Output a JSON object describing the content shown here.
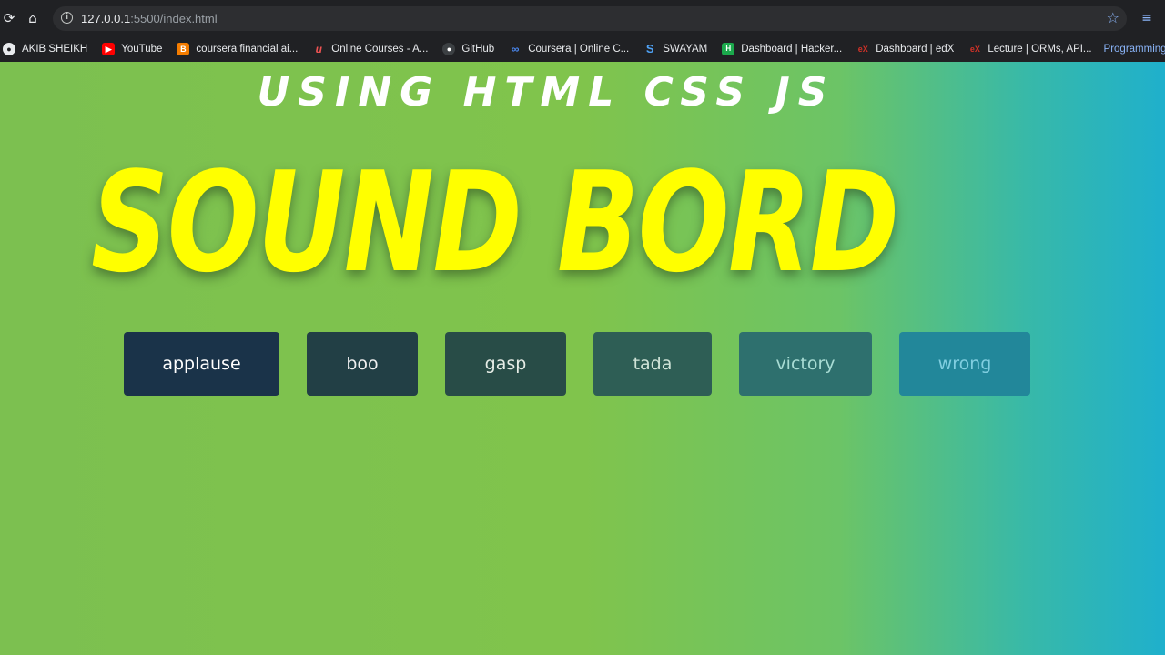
{
  "browser": {
    "url_host": "127.0.0.1",
    "url_path": ":5500/index.html",
    "bookmarks": [
      {
        "label": "AKIB SHEIKH",
        "icon": "globe-icon",
        "color": "#5f6368"
      },
      {
        "label": "YouTube",
        "icon": "youtube-icon",
        "color": "#ff0000"
      },
      {
        "label": "coursera financial ai...",
        "icon": "blogger-icon",
        "color": "#f57d00"
      },
      {
        "label": "Online Courses - A...",
        "icon": "udemy-icon",
        "color": "#ec5252"
      },
      {
        "label": "GitHub",
        "icon": "github-icon",
        "color": "#24292e"
      },
      {
        "label": "Coursera | Online C...",
        "icon": "coursera-icon",
        "color": "#0056d2"
      },
      {
        "label": "SWAYAM",
        "icon": "swayam-icon",
        "color": "#1a73e8"
      },
      {
        "label": "Dashboard | Hacker...",
        "icon": "hackerrank-icon",
        "color": "#2ec866"
      },
      {
        "label": "Dashboard | edX",
        "icon": "edx-icon",
        "color": "#02262b"
      },
      {
        "label": "Lecture | ORMs, API...",
        "icon": "edx-icon",
        "color": "#02262b"
      }
    ],
    "bookmark_overflow": "Programming chall..."
  },
  "page": {
    "subtitle": "USING HTML CSS JS",
    "title": "SOUND BORD",
    "title_color": "#ffff00",
    "buttons": [
      {
        "label": "applause",
        "bg": "#1a3349",
        "fg": "#ffffff"
      },
      {
        "label": "boo",
        "bg": "#223f45",
        "fg": "#f0f0f0"
      },
      {
        "label": "gasp",
        "bg": "#284c47",
        "fg": "#e6ece6"
      },
      {
        "label": "tada",
        "bg": "#2e5e55",
        "fg": "#d0e4d8"
      },
      {
        "label": "victory",
        "bg": "#2e706e",
        "fg": "#a8dcd4"
      },
      {
        "label": "wrong",
        "bg": "#22879a",
        "fg": "#80cee0"
      }
    ]
  }
}
